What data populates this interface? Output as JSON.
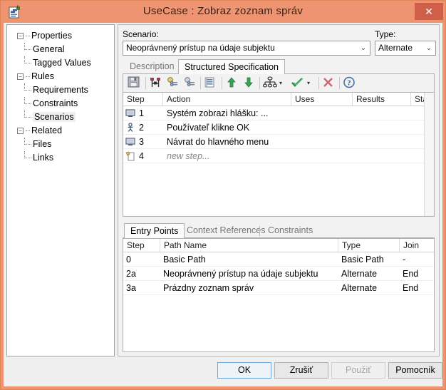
{
  "window": {
    "title": "UseCase : Zobraz zoznam správ",
    "icon": "usecase-document-icon",
    "close_label": "✕",
    "accent_color": "#ef9470",
    "close_color": "#d05f4a"
  },
  "tree": {
    "items": [
      {
        "label": "Properties",
        "level": 0,
        "expander": "−",
        "selected": false
      },
      {
        "label": "General",
        "level": 1,
        "expander": "",
        "selected": false
      },
      {
        "label": "Tagged Values",
        "level": 1,
        "expander": "",
        "selected": false
      },
      {
        "label": "Rules",
        "level": 0,
        "expander": "−",
        "selected": false
      },
      {
        "label": "Requirements",
        "level": 1,
        "expander": "",
        "selected": false
      },
      {
        "label": "Constraints",
        "level": 1,
        "expander": "",
        "selected": false
      },
      {
        "label": "Scenarios",
        "level": 1,
        "expander": "",
        "selected": true
      },
      {
        "label": "Related",
        "level": 0,
        "expander": "−",
        "selected": false
      },
      {
        "label": "Files",
        "level": 1,
        "expander": "",
        "selected": false
      },
      {
        "label": "Links",
        "level": 1,
        "expander": "",
        "selected": false
      }
    ]
  },
  "scenario": {
    "label": "Scenario:",
    "value": "Neoprávnený prístup na údaje subjektu",
    "arrow": "⌄"
  },
  "type": {
    "label": "Type:",
    "value": "Alternate",
    "arrow": "⌄"
  },
  "tabs": {
    "items": [
      {
        "label": "Description",
        "active": false
      },
      {
        "label": "Structured Specification",
        "active": true
      }
    ]
  },
  "toolbar": {
    "buttons": [
      {
        "name": "save-icon"
      },
      {
        "name": "insert-step-icon"
      },
      {
        "name": "link-step-icon"
      },
      {
        "name": "unlink-step-icon"
      },
      {
        "name": "list-view-icon"
      },
      {
        "name": "move-up-icon"
      },
      {
        "name": "move-down-icon"
      },
      {
        "name": "hierarchy-icon"
      },
      {
        "name": "validate-check-icon"
      },
      {
        "name": "delete-cross-icon"
      },
      {
        "name": "help-icon"
      }
    ],
    "caret": "▾"
  },
  "steps_grid": {
    "columns": [
      "Step",
      "Action",
      "Uses",
      "Results",
      "State"
    ],
    "rows": [
      {
        "icon": "system-monitor-icon",
        "step": "1",
        "action": "Systém zobrazi hlášku: ...",
        "uses": "",
        "results": "",
        "state": "",
        "placeholder": false
      },
      {
        "icon": "actor-person-icon",
        "step": "2",
        "action": "Používateľ klikne OK",
        "uses": "",
        "results": "",
        "state": "",
        "placeholder": false
      },
      {
        "icon": "system-monitor-icon",
        "step": "3",
        "action": "Návrat do hlavného menu",
        "uses": "",
        "results": "",
        "state": "",
        "placeholder": false
      },
      {
        "icon": "new-step-icon",
        "step": "4",
        "action": "new step...",
        "uses": "",
        "results": "",
        "state": "",
        "placeholder": true
      }
    ]
  },
  "bottom_tabs": {
    "items": [
      {
        "label": "Entry Points",
        "active": true
      },
      {
        "label": "Context References",
        "active": false
      },
      {
        "label": "Constraints",
        "active": false
      }
    ]
  },
  "entry_points_grid": {
    "columns": [
      "Step",
      "Path Name",
      "Type",
      "Join"
    ],
    "rows": [
      {
        "step": "0",
        "path_name": "Basic Path",
        "type": "Basic Path",
        "join": "-"
      },
      {
        "step": "2a",
        "path_name": "Neoprávnený prístup na údaje subjektu",
        "type": "Alternate",
        "join": "End"
      },
      {
        "step": "3a",
        "path_name": "Prázdny zoznam správ",
        "type": "Alternate",
        "join": "End"
      }
    ]
  },
  "buttons": {
    "ok": "OK",
    "cancel": "Zrušiť",
    "apply": "Použiť",
    "help": "Pomocník"
  }
}
